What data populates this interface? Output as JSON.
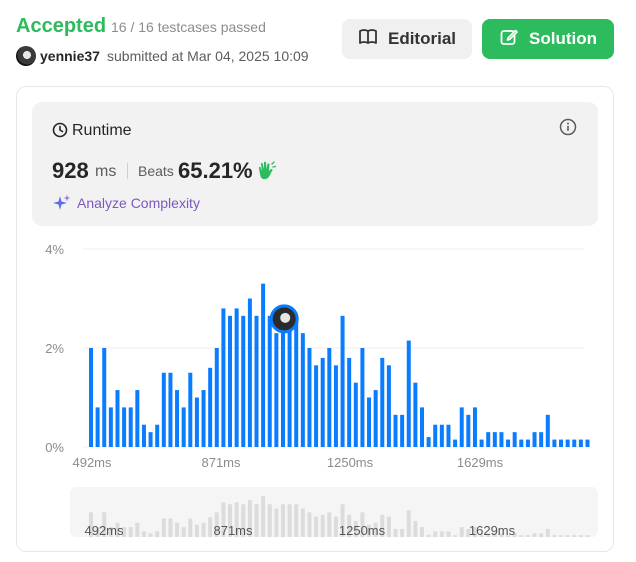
{
  "header": {
    "status": "Accepted",
    "testcases": "16 / 16 testcases passed",
    "username": "yennie37",
    "submitted": "submitted at Mar 04, 2025 10:09",
    "editorial_label": "Editorial",
    "solution_label": "Solution"
  },
  "runtime": {
    "label": "Runtime",
    "value": "928",
    "unit": "ms",
    "beats_label": "Beats",
    "beats_value": "65.21%",
    "analyze_label": "Analyze Complexity"
  },
  "colors": {
    "accent_green": "#2cbb5d",
    "bar_blue": "#0a7cff",
    "analyze_purple": "#7e57c2"
  },
  "chart_data": {
    "type": "bar",
    "y_ticks": [
      "4%",
      "2%",
      "0%"
    ],
    "ylim": [
      0,
      4
    ],
    "x_ticks": [
      "492ms",
      "871ms",
      "1250ms",
      "1629ms"
    ],
    "minimap_ticks": [
      "492ms",
      "871ms",
      "1250ms",
      "1629ms"
    ],
    "highlight_index": 31,
    "values": [
      2.0,
      0.8,
      2.0,
      0.8,
      1.15,
      0.8,
      0.8,
      1.15,
      0.45,
      0.3,
      0.45,
      1.5,
      1.5,
      1.15,
      0.8,
      1.5,
      1.0,
      1.15,
      1.6,
      2.0,
      2.8,
      2.65,
      2.8,
      2.65,
      3.0,
      2.65,
      3.3,
      2.65,
      2.3,
      2.65,
      2.65,
      2.65,
      2.3,
      2.0,
      1.65,
      1.8,
      2.0,
      1.65,
      2.65,
      1.8,
      1.3,
      2.0,
      1.0,
      1.15,
      1.8,
      1.65,
      0.65,
      0.65,
      2.15,
      1.3,
      0.8,
      0.2,
      0.45,
      0.45,
      0.45,
      0.15,
      0.8,
      0.65,
      0.8,
      0.15,
      0.3,
      0.3,
      0.3,
      0.15,
      0.3,
      0.15,
      0.15,
      0.3,
      0.3,
      0.65,
      0.15,
      0.15,
      0.15,
      0.15,
      0.15,
      0.15
    ]
  }
}
